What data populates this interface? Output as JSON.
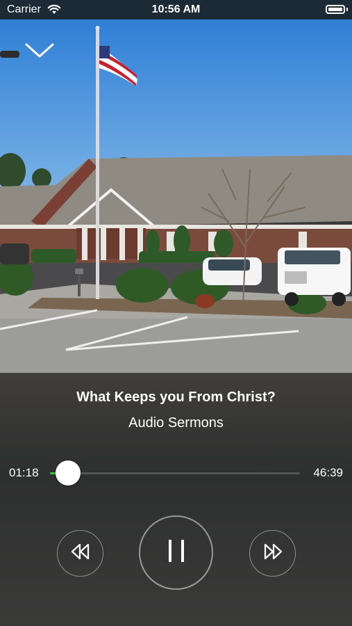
{
  "status_bar": {
    "carrier": "Carrier",
    "time": "10:56 AM",
    "wifi_icon": "wifi-icon",
    "battery_icon": "battery-icon"
  },
  "player": {
    "title": "What Keeps you From Christ?",
    "subtitle": "Audio Sermons",
    "elapsed": "01:18",
    "remaining": "46:39",
    "progress_fraction": 0.028,
    "is_playing": true,
    "accent_color": "#2ecc40"
  },
  "controls": {
    "collapse_icon": "chevron-down-icon",
    "rewind_icon": "rewind-icon",
    "pause_icon": "pause-icon",
    "forward_icon": "fast-forward-icon"
  }
}
